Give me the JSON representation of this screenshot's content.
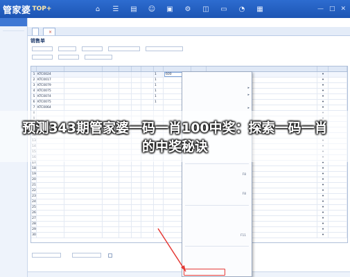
{
  "app": {
    "logo_text": "管家婆",
    "logo_sub": "TOP+",
    "top_icons": [
      "home-icon",
      "list-icon",
      "chart-icon",
      "user-icon",
      "box-icon",
      "gear-icon",
      "cart-icon",
      "doc-icon",
      "bell-icon",
      "grid-icon"
    ],
    "window_controls": [
      "—",
      "□",
      "✕"
    ]
  },
  "sidebar": {
    "header": ""
  },
  "tabs": [
    {
      "label": ""
    },
    {
      "label": ""
    }
  ],
  "form": {
    "title": "销售单",
    "row1": [
      {
        "label": "",
        "value": ""
      },
      {
        "label": "",
        "value": ""
      },
      {
        "label": "",
        "value": ""
      },
      {
        "label": "",
        "value": ""
      },
      {
        "label": "",
        "value": ""
      }
    ],
    "row2": [
      {
        "label": "",
        "value": ""
      },
      {
        "label": "",
        "value": ""
      },
      {
        "label": "",
        "value": ""
      }
    ]
  },
  "grid": {
    "headers": [
      "",
      "",
      "",
      "",
      "",
      "",
      "",
      "",
      "",
      ""
    ],
    "rows": [
      {
        "n": "1",
        "code": "KTC0024",
        "name": "",
        "qty": "1"
      },
      {
        "n": "2",
        "code": "KTC0017",
        "name": "",
        "qty": "1"
      },
      {
        "n": "3",
        "code": "KTC0079",
        "name": "",
        "qty": "1"
      },
      {
        "n": "4",
        "code": "KTC0075",
        "name": "",
        "qty": "1"
      },
      {
        "n": "5",
        "code": "KTC0074",
        "name": "",
        "qty": "1"
      },
      {
        "n": "6",
        "code": "KTC0075",
        "name": "",
        "qty": "1"
      },
      {
        "n": "7",
        "code": "KTC0064",
        "name": "",
        "qty": ""
      },
      {
        "n": "8",
        "code": "",
        "name": "",
        "qty": ""
      },
      {
        "n": "9",
        "code": "",
        "name": "",
        "qty": ""
      },
      {
        "n": "10",
        "code": "",
        "name": "",
        "qty": ""
      },
      {
        "n": "11",
        "code": "",
        "name": "",
        "qty": ""
      },
      {
        "n": "12",
        "code": "",
        "name": "",
        "qty": ""
      },
      {
        "n": "13",
        "code": "",
        "name": "",
        "qty": ""
      },
      {
        "n": "14",
        "code": "",
        "name": "",
        "qty": ""
      },
      {
        "n": "15",
        "code": "",
        "name": "",
        "qty": ""
      },
      {
        "n": "16",
        "code": "",
        "name": "",
        "qty": ""
      },
      {
        "n": "17",
        "code": "",
        "name": "",
        "qty": ""
      },
      {
        "n": "18",
        "code": "",
        "name": "",
        "qty": ""
      },
      {
        "n": "19",
        "code": "",
        "name": "",
        "qty": ""
      },
      {
        "n": "20",
        "code": "",
        "name": "",
        "qty": ""
      },
      {
        "n": "21",
        "code": "",
        "name": "",
        "qty": ""
      },
      {
        "n": "22",
        "code": "",
        "name": "",
        "qty": ""
      },
      {
        "n": "23",
        "code": "",
        "name": "",
        "qty": ""
      },
      {
        "n": "24",
        "code": "",
        "name": "",
        "qty": ""
      },
      {
        "n": "25",
        "code": "",
        "name": "",
        "qty": ""
      },
      {
        "n": "26",
        "code": "",
        "name": "",
        "qty": ""
      },
      {
        "n": "27",
        "code": "",
        "name": "",
        "qty": ""
      },
      {
        "n": "28",
        "code": "",
        "name": "",
        "qty": ""
      },
      {
        "n": "29",
        "code": "",
        "name": "",
        "qty": ""
      },
      {
        "n": "30",
        "code": "",
        "name": "",
        "qty": ""
      }
    ],
    "active_amount": "600"
  },
  "context_menu": {
    "items": [
      {
        "label": "",
        "shortcut": ""
      },
      {
        "label": "",
        "shortcut": ""
      },
      {
        "label": "",
        "shortcut": ""
      },
      {
        "label": "",
        "shortcut": ""
      },
      {
        "label": "",
        "shortcut": ""
      },
      {
        "label": "",
        "shortcut": ""
      },
      {
        "label": "",
        "shortcut": ""
      },
      {
        "label": "",
        "shortcut": ""
      },
      {
        "label": "",
        "shortcut": ""
      },
      {
        "label": "",
        "shortcut": ""
      },
      {
        "label": "",
        "shortcut": ""
      },
      {
        "label": "",
        "shortcut": ""
      },
      {
        "label": "",
        "shortcut": ""
      },
      {
        "label": "",
        "shortcut": ""
      },
      {
        "label": "",
        "shortcut": ""
      },
      {
        "label": "",
        "shortcut": "F8"
      },
      {
        "label": "",
        "shortcut": ""
      },
      {
        "label": "",
        "shortcut": ""
      },
      {
        "label": "",
        "shortcut": "F8"
      },
      {
        "label": "",
        "shortcut": ""
      },
      {
        "label": "",
        "shortcut": ""
      },
      {
        "label": "",
        "shortcut": ""
      },
      {
        "label": "",
        "shortcut": ""
      },
      {
        "label": "",
        "shortcut": ""
      },
      {
        "label": "",
        "shortcut": "F11"
      },
      {
        "label": "",
        "shortcut": ""
      },
      {
        "label": "",
        "shortcut": ""
      },
      {
        "label": "",
        "shortcut": ""
      },
      {
        "label": "",
        "shortcut": ""
      },
      {
        "label": "",
        "shortcut": ""
      }
    ]
  },
  "footer": {
    "field1_label": "",
    "field2_label": ""
  },
  "headline": "预测343期管家婆一码一肖100中奖：探索一码一肖的中奖秘诀",
  "colors": {
    "topbar": "#1d55b3",
    "accent": "#3f78d4",
    "highlight_border": "#e53935",
    "headline_text": "#ffffff"
  }
}
